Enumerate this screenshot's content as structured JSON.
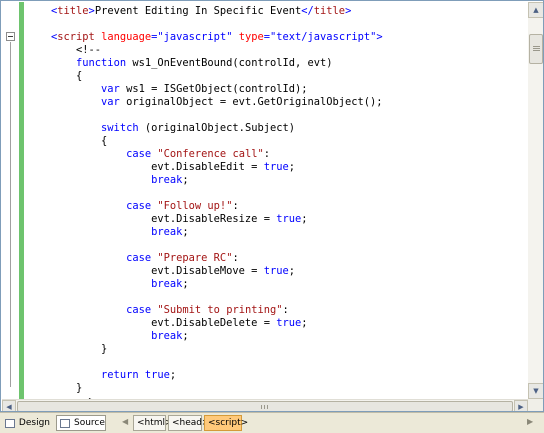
{
  "code_lines": [
    {
      "tokens": [
        {
          "c": "tok-blue",
          "t": "<"
        },
        {
          "c": "tok-maroon",
          "t": "title"
        },
        {
          "c": "tok-blue",
          "t": ">"
        },
        {
          "c": "tok-black",
          "t": "Prevent Editing In Specific Event"
        },
        {
          "c": "tok-blue",
          "t": "</"
        },
        {
          "c": "tok-maroon",
          "t": "title"
        },
        {
          "c": "tok-blue",
          "t": ">"
        }
      ]
    },
    {
      "tokens": []
    },
    {
      "tokens": [
        {
          "c": "tok-blue",
          "t": "<"
        },
        {
          "c": "tok-maroon",
          "t": "script"
        },
        {
          "c": "tok-black",
          "t": " "
        },
        {
          "c": "tok-red",
          "t": "language"
        },
        {
          "c": "tok-blue",
          "t": "=\"javascript\""
        },
        {
          "c": "tok-black",
          "t": " "
        },
        {
          "c": "tok-red",
          "t": "type"
        },
        {
          "c": "tok-blue",
          "t": "=\"text/javascript\">"
        }
      ]
    },
    {
      "tokens": [
        {
          "c": "tok-black",
          "t": "    <!--"
        }
      ]
    },
    {
      "tokens": [
        {
          "c": "tok-black",
          "t": "    "
        },
        {
          "c": "tok-blue",
          "t": "function"
        },
        {
          "c": "tok-black",
          "t": " ws1_OnEventBound(controlId, evt)"
        }
      ]
    },
    {
      "tokens": [
        {
          "c": "tok-black",
          "t": "    {"
        }
      ]
    },
    {
      "tokens": [
        {
          "c": "tok-black",
          "t": "        "
        },
        {
          "c": "tok-blue",
          "t": "var"
        },
        {
          "c": "tok-black",
          "t": " ws1 = ISGetObject(controlId);"
        }
      ]
    },
    {
      "tokens": [
        {
          "c": "tok-black",
          "t": "        "
        },
        {
          "c": "tok-blue",
          "t": "var"
        },
        {
          "c": "tok-black",
          "t": " originalObject = evt.GetOriginalObject();"
        }
      ]
    },
    {
      "tokens": []
    },
    {
      "tokens": [
        {
          "c": "tok-black",
          "t": "        "
        },
        {
          "c": "tok-blue",
          "t": "switch"
        },
        {
          "c": "tok-black",
          "t": " (originalObject.Subject)"
        }
      ]
    },
    {
      "tokens": [
        {
          "c": "tok-black",
          "t": "        {"
        }
      ]
    },
    {
      "tokens": [
        {
          "c": "tok-black",
          "t": "            "
        },
        {
          "c": "tok-blue",
          "t": "case"
        },
        {
          "c": "tok-black",
          "t": " "
        },
        {
          "c": "tok-str",
          "t": "\"Conference call\""
        },
        {
          "c": "tok-black",
          "t": ":"
        }
      ]
    },
    {
      "tokens": [
        {
          "c": "tok-black",
          "t": "                evt.DisableEdit = "
        },
        {
          "c": "tok-blue",
          "t": "true"
        },
        {
          "c": "tok-black",
          "t": ";"
        }
      ]
    },
    {
      "tokens": [
        {
          "c": "tok-black",
          "t": "                "
        },
        {
          "c": "tok-blue",
          "t": "break"
        },
        {
          "c": "tok-black",
          "t": ";"
        }
      ]
    },
    {
      "tokens": []
    },
    {
      "tokens": [
        {
          "c": "tok-black",
          "t": "            "
        },
        {
          "c": "tok-blue",
          "t": "case"
        },
        {
          "c": "tok-black",
          "t": " "
        },
        {
          "c": "tok-str",
          "t": "\"Follow up!\""
        },
        {
          "c": "tok-black",
          "t": ":"
        }
      ]
    },
    {
      "tokens": [
        {
          "c": "tok-black",
          "t": "                evt.DisableResize = "
        },
        {
          "c": "tok-blue",
          "t": "true"
        },
        {
          "c": "tok-black",
          "t": ";"
        }
      ]
    },
    {
      "tokens": [
        {
          "c": "tok-black",
          "t": "                "
        },
        {
          "c": "tok-blue",
          "t": "break"
        },
        {
          "c": "tok-black",
          "t": ";"
        }
      ]
    },
    {
      "tokens": []
    },
    {
      "tokens": [
        {
          "c": "tok-black",
          "t": "            "
        },
        {
          "c": "tok-blue",
          "t": "case"
        },
        {
          "c": "tok-black",
          "t": " "
        },
        {
          "c": "tok-str",
          "t": "\"Prepare RC\""
        },
        {
          "c": "tok-black",
          "t": ":"
        }
      ]
    },
    {
      "tokens": [
        {
          "c": "tok-black",
          "t": "                evt.DisableMove = "
        },
        {
          "c": "tok-blue",
          "t": "true"
        },
        {
          "c": "tok-black",
          "t": ";"
        }
      ]
    },
    {
      "tokens": [
        {
          "c": "tok-black",
          "t": "                "
        },
        {
          "c": "tok-blue",
          "t": "break"
        },
        {
          "c": "tok-black",
          "t": ";"
        }
      ]
    },
    {
      "tokens": []
    },
    {
      "tokens": [
        {
          "c": "tok-black",
          "t": "            "
        },
        {
          "c": "tok-blue",
          "t": "case"
        },
        {
          "c": "tok-black",
          "t": " "
        },
        {
          "c": "tok-str",
          "t": "\"Submit to printing\""
        },
        {
          "c": "tok-black",
          "t": ":"
        }
      ]
    },
    {
      "tokens": [
        {
          "c": "tok-black",
          "t": "                evt.DisableDelete = "
        },
        {
          "c": "tok-blue",
          "t": "true"
        },
        {
          "c": "tok-black",
          "t": ";"
        }
      ]
    },
    {
      "tokens": [
        {
          "c": "tok-black",
          "t": "                "
        },
        {
          "c": "tok-blue",
          "t": "break"
        },
        {
          "c": "tok-black",
          "t": ";"
        }
      ]
    },
    {
      "tokens": [
        {
          "c": "tok-black",
          "t": "        }"
        }
      ]
    },
    {
      "tokens": []
    },
    {
      "tokens": [
        {
          "c": "tok-black",
          "t": "        "
        },
        {
          "c": "tok-blue",
          "t": "return"
        },
        {
          "c": "tok-black",
          "t": " "
        },
        {
          "c": "tok-blue",
          "t": "true"
        },
        {
          "c": "tok-black",
          "t": ";"
        }
      ]
    },
    {
      "tokens": [
        {
          "c": "tok-black",
          "t": "    }"
        }
      ]
    },
    {
      "tokens": [
        {
          "c": "tok-black",
          "t": "    -->"
        }
      ]
    }
  ],
  "bottom_bar": {
    "design_label": "Design",
    "source_label": "Source",
    "design_icon": "design-view-icon",
    "source_icon": "source-view-icon",
    "breadcrumbs": [
      "<html>",
      "<head>",
      "<script>"
    ],
    "active_breadcrumb": "<script>"
  },
  "scrollbars": {
    "up_arrow": "▲",
    "down_arrow": "▼",
    "left_arrow": "◀",
    "right_arrow": "▶"
  },
  "colors": {
    "keyword": "#0000ff",
    "tag_name": "#a31515",
    "attribute": "#ff0000",
    "string": "#a31515",
    "change_bar": "#6ec46e",
    "active_crumb": "#ffc97a"
  }
}
